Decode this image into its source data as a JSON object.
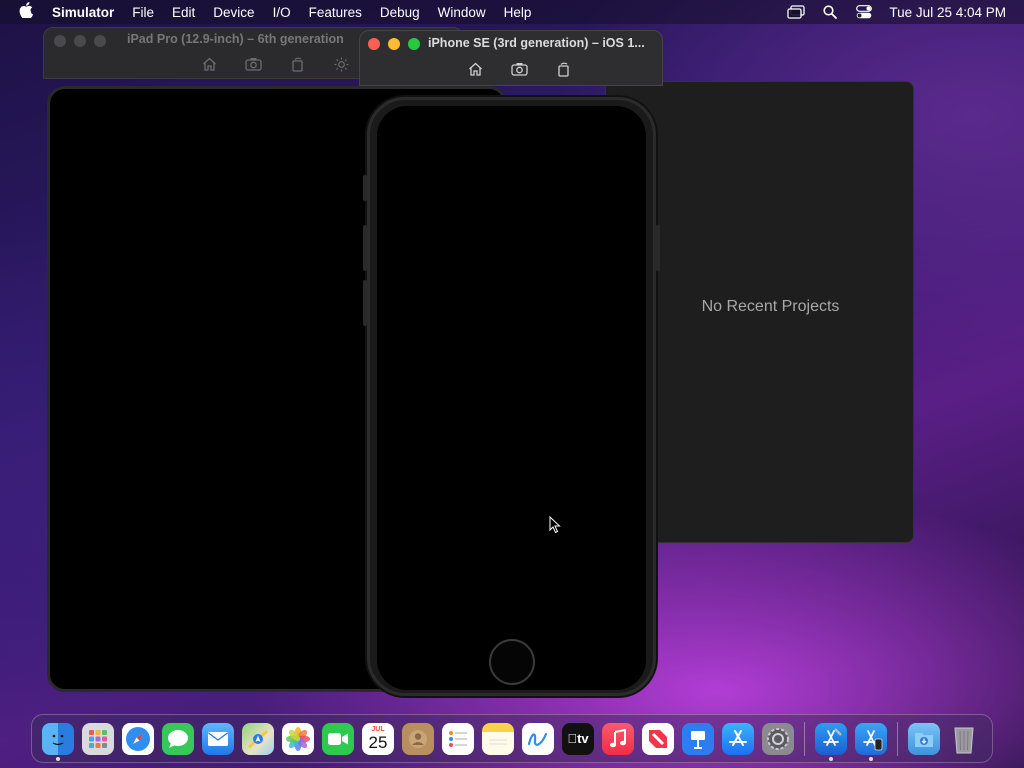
{
  "menubar": {
    "app_name": "Simulator",
    "items": [
      "File",
      "Edit",
      "Device",
      "I/O",
      "Features",
      "Debug",
      "Window",
      "Help"
    ],
    "clock": "Tue Jul 25  4:04 PM"
  },
  "ipad_window": {
    "title": "iPad Pro (12.9-inch) – 6th generation"
  },
  "iphone_window": {
    "title": "iPhone SE (3rd generation) – iOS 1..."
  },
  "xcode_window": {
    "empty_message": "No Recent Projects"
  },
  "dock": {
    "calendar_month": "JUL",
    "calendar_day": "25",
    "tv_label": "tv"
  }
}
